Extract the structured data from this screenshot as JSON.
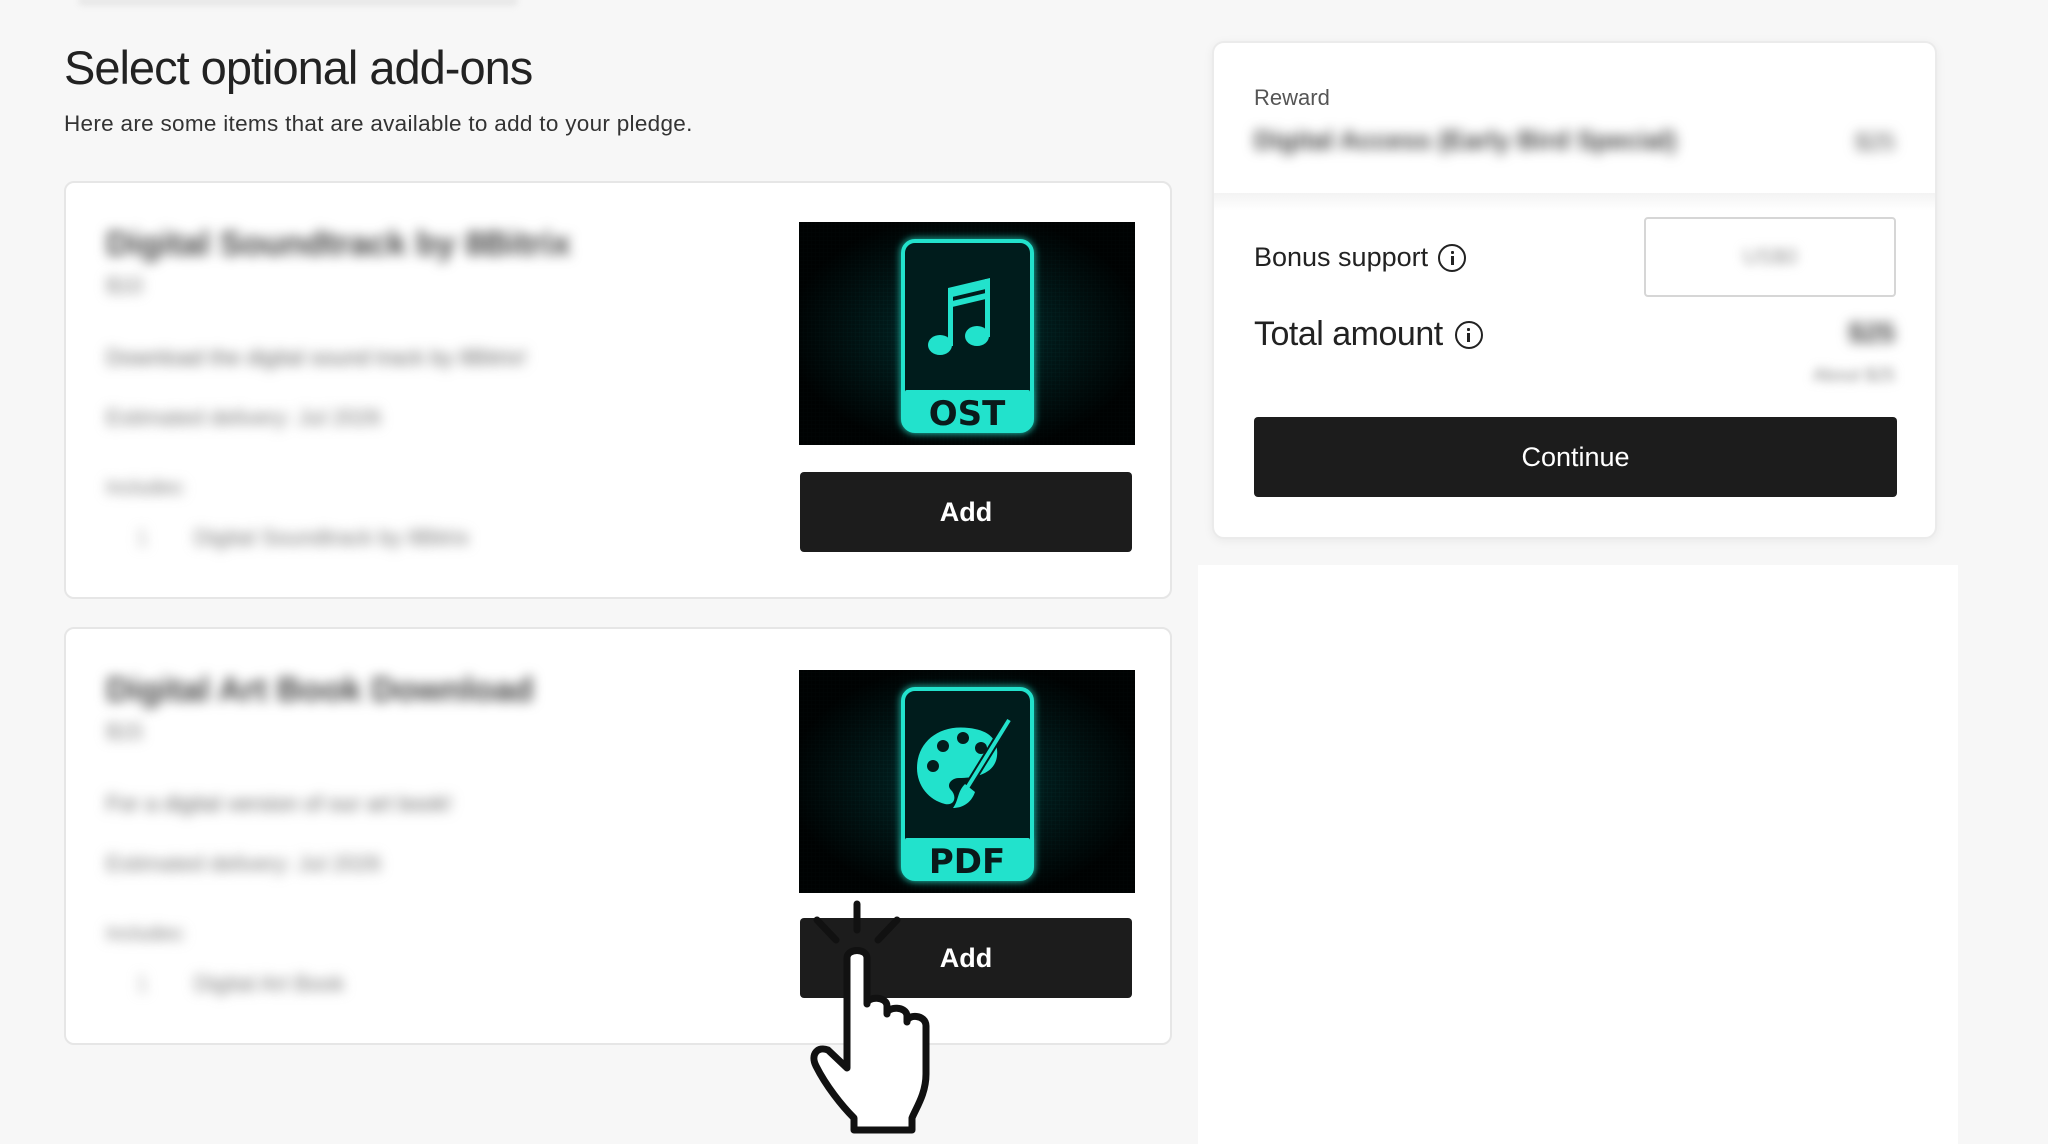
{
  "page": {
    "title": "Select optional add-ons",
    "subtitle": "Here are some items that are available to add to your pledge."
  },
  "addons": [
    {
      "title": "Digital Soundtrack by 8Bitrix",
      "price": "$10",
      "description": "Download the digital sound track by 8Bitrix!",
      "delivery": "Estimated delivery: Jul 2026",
      "includes_label": "Includes:",
      "includes_qty": "1",
      "includes_item": "Digital Soundtrack by 8Bitrix",
      "image_icon": "music-note-icon",
      "image_label": "OST",
      "add_label": "Add"
    },
    {
      "title": "Digital Art Book Download",
      "price": "$15",
      "description": "For a digital version of our art book!",
      "delivery": "Estimated delivery: Jul 2026",
      "includes_label": "Includes:",
      "includes_qty": "1",
      "includes_item": "Digital Art Book",
      "image_icon": "palette-icon",
      "image_label": "PDF",
      "add_label": "Add"
    }
  ],
  "summary": {
    "reward_label": "Reward",
    "reward_name": "Digital Access (Early Bird Special)",
    "reward_price": "$25",
    "bonus_label": "Bonus support",
    "bonus_value": "US$0",
    "total_label": "Total amount",
    "total_value": "$25",
    "total_note": "About $25",
    "continue_label": "Continue"
  },
  "colors": {
    "accent": "#1c1c1c",
    "image_glow": "#20e0c8",
    "background": "#f7f7f7"
  }
}
